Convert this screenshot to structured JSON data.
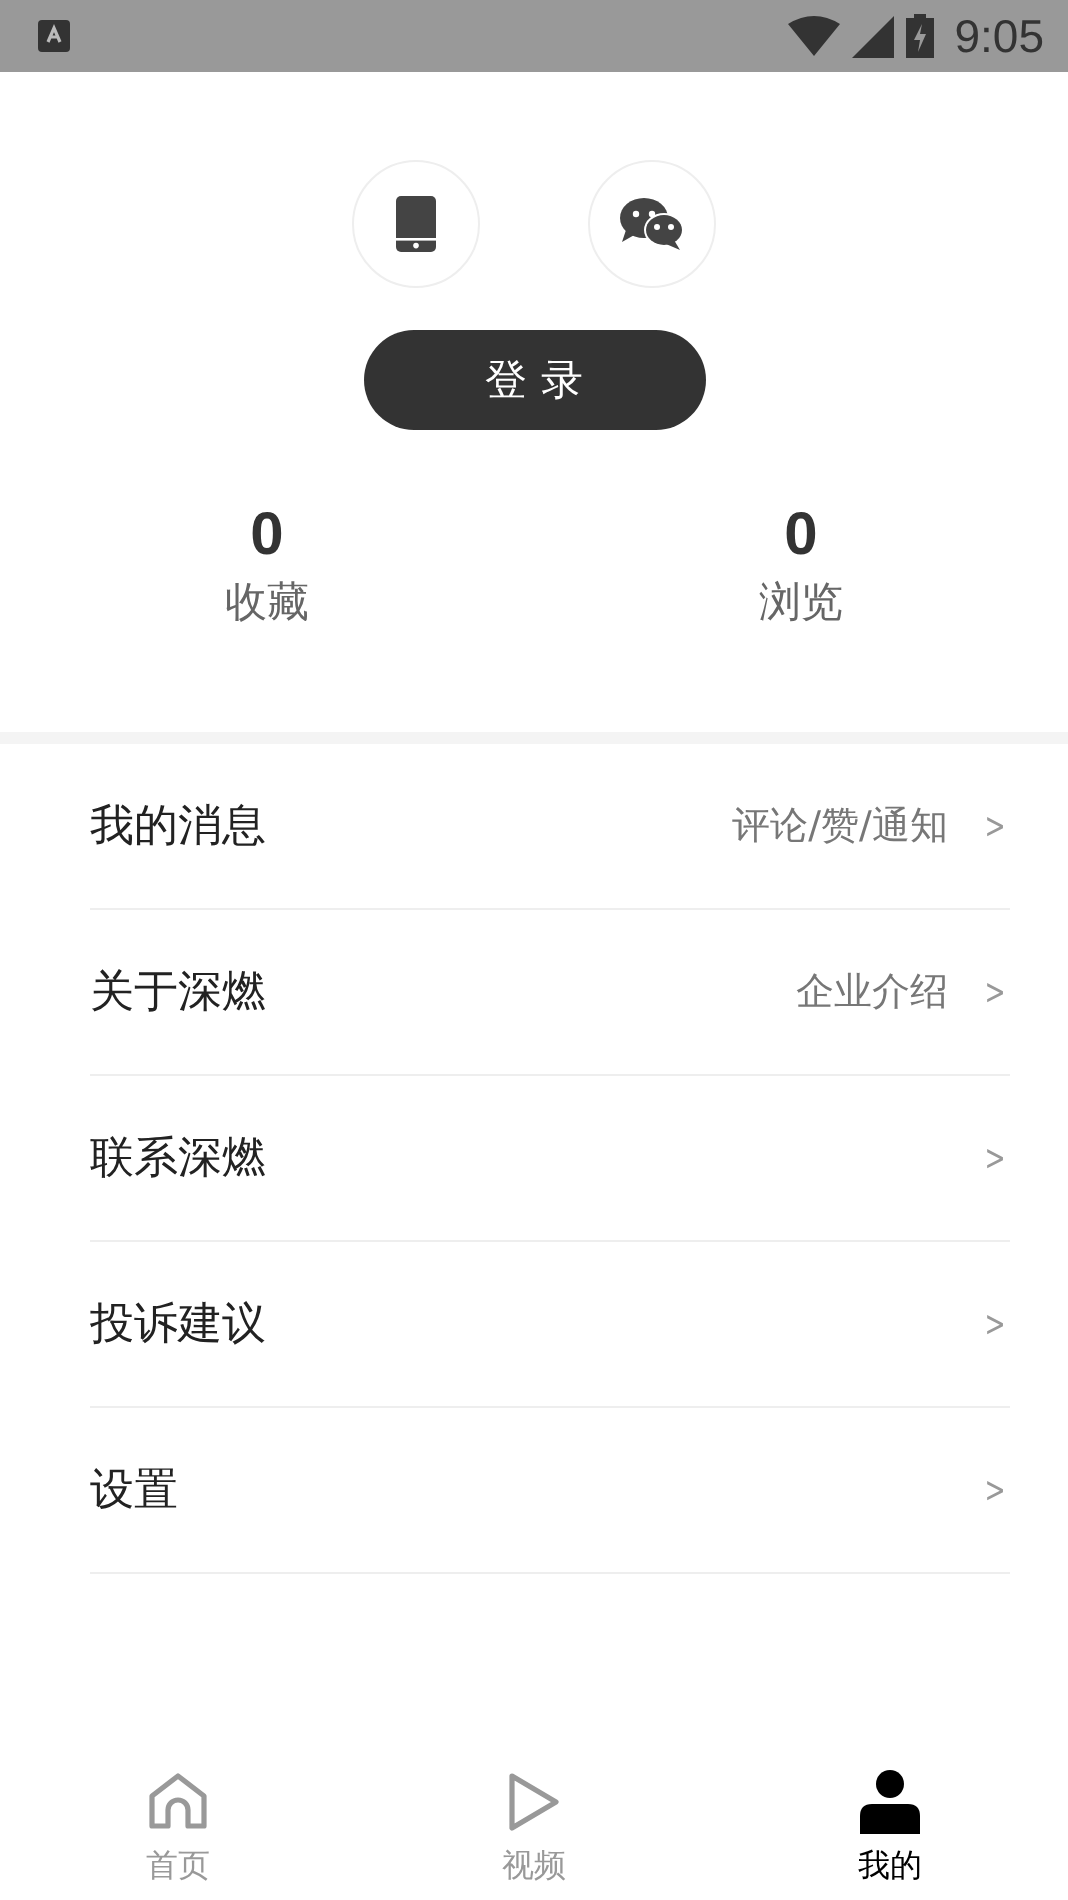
{
  "status_bar": {
    "time": "9:05"
  },
  "login_button": "登 录",
  "stats": [
    {
      "value": "0",
      "label": "收藏"
    },
    {
      "value": "0",
      "label": "浏览"
    }
  ],
  "menu": [
    {
      "label": "我的消息",
      "hint": "评论/赞/通知"
    },
    {
      "label": "关于深燃",
      "hint": "企业介绍"
    },
    {
      "label": "联系深燃"
    },
    {
      "label": "投诉建议"
    },
    {
      "label": "设置"
    }
  ],
  "chevron": ">",
  "tabs": [
    {
      "kind": "home",
      "label": "首页",
      "selected": false
    },
    {
      "kind": "video",
      "label": "视频",
      "selected": false
    },
    {
      "kind": "me",
      "label": "我的",
      "selected": true
    }
  ]
}
